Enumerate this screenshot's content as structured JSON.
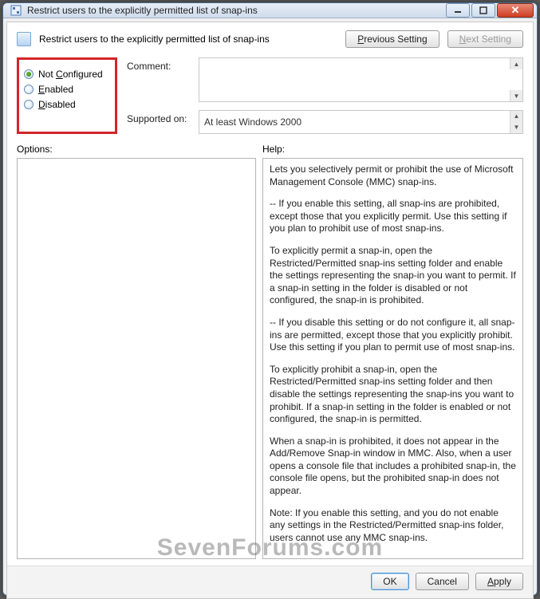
{
  "window": {
    "title": "Restrict users to the explicitly permitted list of snap-ins"
  },
  "header": {
    "policy_name": "Restrict users to the explicitly permitted list of snap-ins",
    "previous_prefix": "P",
    "previous_rest": "revious Setting",
    "next_prefix": "N",
    "next_rest": "ext Setting"
  },
  "state": {
    "not_configured_prefix": "C",
    "not_configured_label": "Not ",
    "not_configured_rest": "onfigured",
    "enabled_prefix": "E",
    "enabled_rest": "nabled",
    "disabled_prefix": "D",
    "disabled_rest": "isabled",
    "selected": "not_configured"
  },
  "fields": {
    "comment_label": "Comment:",
    "comment_value": "",
    "supported_label": "Supported on:",
    "supported_value": "At least Windows 2000"
  },
  "panes": {
    "options_label": "Options:",
    "help_label": "Help:"
  },
  "help": {
    "p1": "Lets you selectively permit or prohibit the use of Microsoft Management Console (MMC) snap-ins.",
    "p2": "--  If you enable this setting, all snap-ins are prohibited, except those that you explicitly permit. Use this setting if you plan to prohibit use of most snap-ins.",
    "p3": "    To explicitly permit a snap-in, open the Restricted/Permitted snap-ins setting folder and enable the settings representing the snap-in you want to permit. If a snap-in setting in the folder is disabled or not configured, the snap-in is prohibited.",
    "p4": "--  If you disable this setting or do not configure it, all snap-ins are permitted, except those that you explicitly prohibit. Use this setting if you plan to permit use of most snap-ins.",
    "p5": "    To explicitly prohibit a snap-in, open the Restricted/Permitted snap-ins setting folder and then disable the settings representing the snap-ins you want to prohibit. If a snap-in setting in the folder is enabled or not configured, the snap-in is permitted.",
    "p6": "When a snap-in is prohibited, it does not appear in the Add/Remove Snap-in window in MMC. Also, when a user opens a console file that includes a prohibited snap-in, the console file opens, but the prohibited snap-in does not appear.",
    "p7": "Note: If you enable this setting, and you do not enable any settings in the Restricted/Permitted snap-ins folder, users cannot use any MMC snap-ins."
  },
  "footer": {
    "ok": "OK",
    "cancel": "Cancel",
    "apply_prefix": "A",
    "apply_rest": "pply"
  },
  "watermark": "SevenForums.com"
}
